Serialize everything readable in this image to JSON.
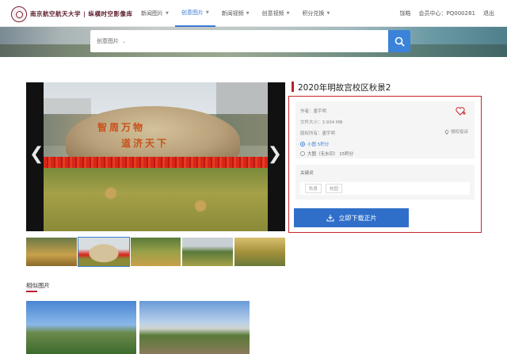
{
  "header": {
    "logo_text": "南京航空航天大学 | 纵横时空影像库",
    "nav": [
      {
        "label": "新闻图片",
        "active": false
      },
      {
        "label": "创意图片",
        "active": true
      },
      {
        "label": "新闻视频",
        "active": false
      },
      {
        "label": "创意视频",
        "active": false
      },
      {
        "label": "积分兑换",
        "active": false
      }
    ],
    "user_name": "饶皓",
    "member_label": "会员中心",
    "member_id": "PQ000281",
    "logout_label": "退出"
  },
  "search": {
    "category": "创意图片",
    "placeholder": ""
  },
  "photo": {
    "rock_text_line1": "智周万物",
    "rock_text_line2": "道济天下",
    "prev_arrow": "❮",
    "next_arrow": "❯"
  },
  "detail": {
    "title": "2020年明故宫校区秋景2",
    "author": "作者：唐宇明",
    "file_size": "文件大小：3.934 MB",
    "copyright": "版权所有：唐宇明",
    "report_label": "侵权投诉",
    "options": [
      {
        "label": "小图 5积分",
        "selected": true
      },
      {
        "label": "大图（无水印） 15积分",
        "selected": false
      }
    ],
    "keywords_label": "关键词",
    "keywords": [
      "秋景",
      "校园"
    ],
    "download_label": "立即下载正片"
  },
  "similar": {
    "title": "相似图片"
  },
  "colors": {
    "accent_blue": "#2f6fc9",
    "highlight_red": "#c9252b"
  }
}
